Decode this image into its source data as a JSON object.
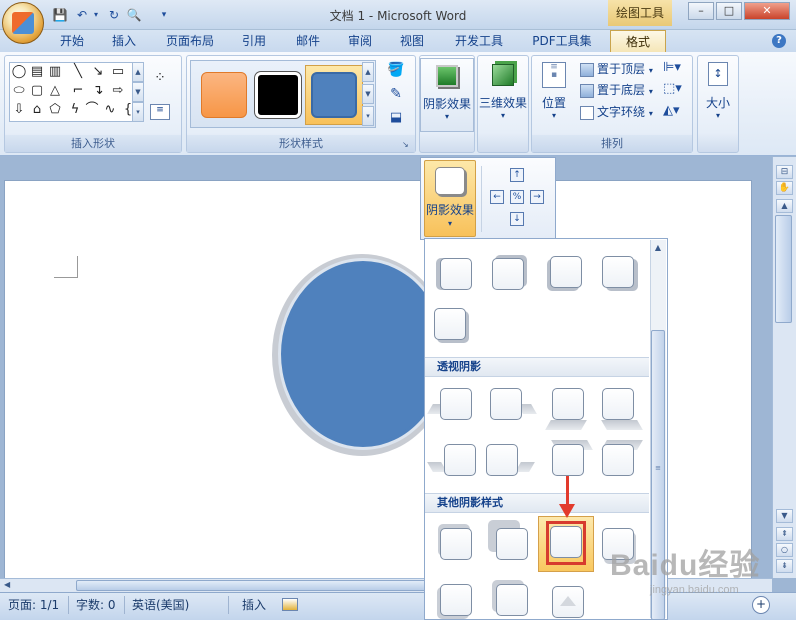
{
  "window": {
    "title": "文档 1 - Microsoft Word",
    "context_tab_header": "绘图工具",
    "controls": {
      "minimize": "–",
      "maximize": "□",
      "close": "✕"
    }
  },
  "quick_access": [
    "save-icon",
    "undo-icon",
    "redo-icon",
    "print-preview-icon"
  ],
  "tabs": [
    {
      "label": "开始"
    },
    {
      "label": "插入"
    },
    {
      "label": "页面布局"
    },
    {
      "label": "引用"
    },
    {
      "label": "邮件"
    },
    {
      "label": "审阅"
    },
    {
      "label": "视图"
    },
    {
      "label": "开发工具"
    },
    {
      "label": "PDF工具集"
    },
    {
      "label": "格式",
      "active": true
    }
  ],
  "ribbon": {
    "insert_shapes_label": "插入形状",
    "shape_styles_label": "形状样式",
    "shadow_effects_label": "阴影效果",
    "three_d_effects_label": "三维效果",
    "position_label": "位置",
    "bring_to_front": "置于顶层",
    "send_to_back": "置于底层",
    "text_wrap": "文字环绕",
    "arrange_label": "排列",
    "size_label": "大小",
    "swatch_colors": [
      "#f79646",
      "#000000",
      "#4f81bd"
    ]
  },
  "dropdown": {
    "shadow_button_label": "阴影效果",
    "sections": [
      {
        "title": "透视阴影"
      },
      {
        "title": "其他阴影样式"
      }
    ]
  },
  "statusbar": {
    "page": "页面: 1/1",
    "words": "字数: 0",
    "language": "英语(美国)",
    "mode": "插入"
  },
  "watermark": {
    "brand": "Baidu经验",
    "url": "jingyan.baidu.com"
  }
}
